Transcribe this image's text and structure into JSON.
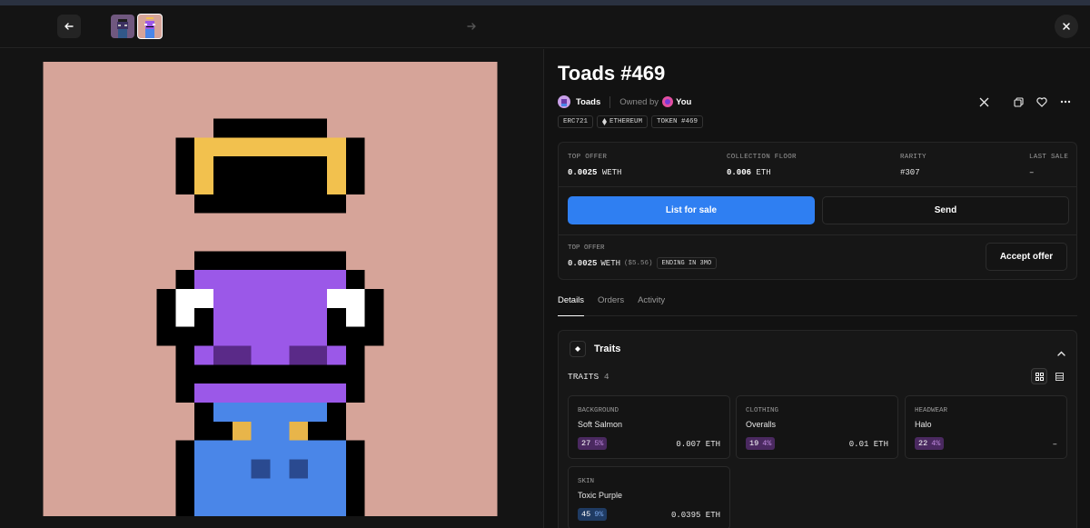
{
  "nav": {
    "back_icon": "arrow-left-icon",
    "forward_icon": "arrow-right-icon",
    "close_icon": "close-icon",
    "thumbnails": [
      {
        "name": "toad-thumbnail-1",
        "selected": false
      },
      {
        "name": "toad-thumbnail-469",
        "selected": true
      }
    ]
  },
  "item": {
    "title": "Toads #469",
    "collection": "Toads",
    "owned_by_label": "Owned by",
    "owner": "You",
    "tags": [
      "ERC721",
      "ETHEREUM",
      "TOKEN #469"
    ]
  },
  "stats": {
    "top_offer_label": "TOP OFFER",
    "top_offer_value": "0.0025",
    "top_offer_unit": "WETH",
    "floor_label": "COLLECTION FLOOR",
    "floor_value": "0.006",
    "floor_unit": "ETH",
    "rarity_label": "RARITY",
    "rarity_value": "#307",
    "last_sale_label": "LAST SALE",
    "last_sale_value": "–"
  },
  "actions": {
    "list_label": "List for sale",
    "send_label": "Send",
    "accept_label": "Accept offer"
  },
  "offer": {
    "label": "TOP OFFER",
    "value": "0.0025",
    "unit": "WETH",
    "usd": "($5.56)",
    "ending": "ENDING IN 3MO"
  },
  "tabs": [
    "Details",
    "Orders",
    "Activity"
  ],
  "traits": {
    "heading": "Traits",
    "count_label": "TRAITS",
    "count": "4",
    "items": [
      {
        "type": "BACKGROUND",
        "value": "Soft Salmon",
        "count": "27",
        "pct": "5%",
        "price": "0.007 ETH",
        "color": "purple"
      },
      {
        "type": "CLOTHING",
        "value": "Overalls",
        "count": "19",
        "pct": "4%",
        "price": "0.01 ETH",
        "color": "purple"
      },
      {
        "type": "HEADWEAR",
        "value": "Halo",
        "count": "22",
        "pct": "4%",
        "price": "–",
        "color": "purple"
      },
      {
        "type": "SKIN",
        "value": "Toxic Purple",
        "count": "45",
        "pct": "9%",
        "price": "0.0395 ETH",
        "color": "blue"
      }
    ]
  },
  "colors": {
    "accent": "#2f7ff2",
    "art_background": "#d6a499",
    "toad_skin": "#9b58e8",
    "halo": "#f2c14e",
    "overalls": "#4a86e8"
  }
}
